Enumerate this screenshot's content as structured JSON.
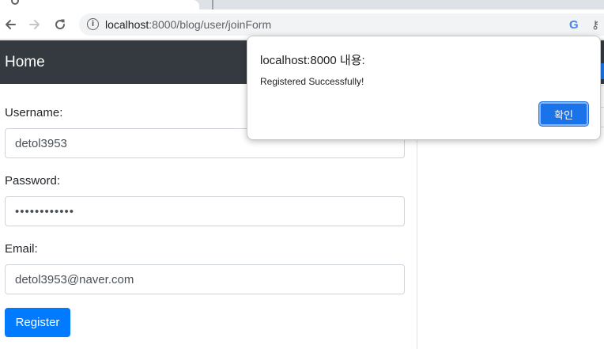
{
  "browser": {
    "url_host": "localhost",
    "url_path": ":8000/blog/user/joinForm",
    "icons": [
      "back-arrow-icon",
      "forward-arrow-icon",
      "reload-icon",
      "info-icon",
      "google-icon",
      "key-icon"
    ],
    "google_letter": "G",
    "back_glyph": "←",
    "forward_glyph": "→",
    "reload_glyph": "↻",
    "info_glyph": "i",
    "key_glyph": "⚷"
  },
  "navbar": {
    "brand": "Home",
    "background": "#343a40"
  },
  "form": {
    "username_label": "Username:",
    "username_value": "detol3953",
    "password_label": "Password:",
    "password_value": "••••••••••••",
    "email_label": "Email:",
    "email_value": "detol3953@naver.com",
    "register_label": "Register",
    "register_color": "#007bff"
  },
  "dialog": {
    "title": "localhost:8000 내용:",
    "message": "Registered Successfully!",
    "ok_label": "확인",
    "ok_color": "#1a73e8"
  }
}
